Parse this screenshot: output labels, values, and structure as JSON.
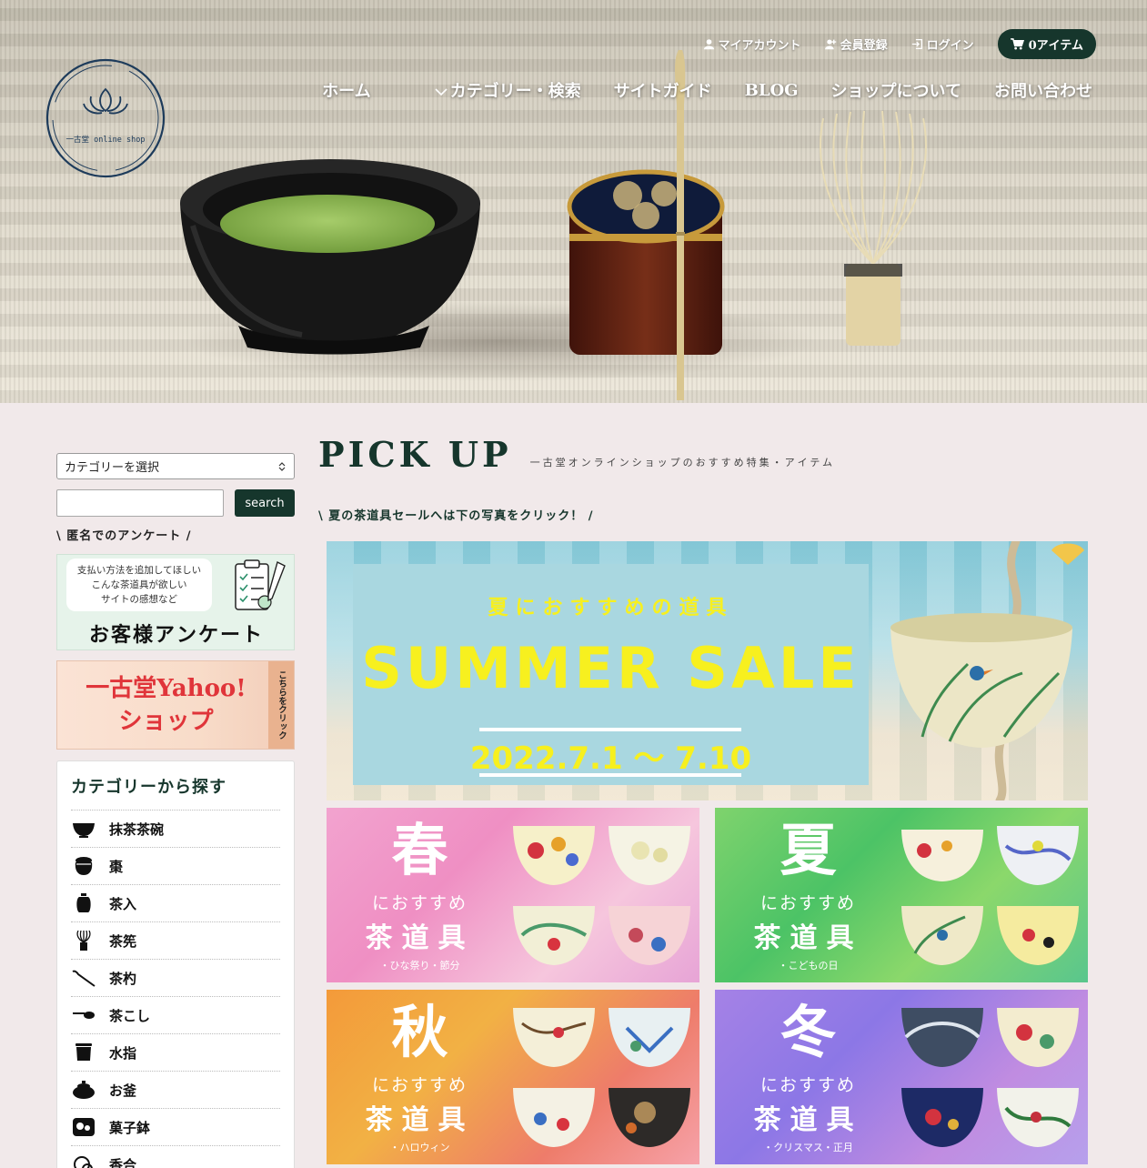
{
  "header": {
    "logo_text": "一古堂 online shop",
    "top_links": [
      {
        "label": "マイアカウント",
        "icon": "user-icon"
      },
      {
        "label": "会員登録",
        "icon": "user-plus-icon"
      },
      {
        "label": "ログイン",
        "icon": "login-icon"
      }
    ],
    "cart_label": "0アイテム",
    "nav": [
      "ホーム",
      "カテゴリー・検索",
      "サイトガイド",
      "BLOG",
      "ショップについて",
      "お問い合わせ"
    ]
  },
  "sidebar": {
    "category_select": "カテゴリーを選択",
    "search_input": "",
    "search_button": "search",
    "survey_label": "\\ 匿名でのアンケート /",
    "survey_banner": {
      "bubble_lines": [
        "支払い方法を追加してほしい",
        "こんな茶道具が欲しい",
        "サイトの感想など"
      ],
      "title": "お客様アンケート"
    },
    "yahoo_banner": {
      "line1": "一古堂Yahoo!",
      "line2": "ショップ",
      "side": "こちらをクリック"
    },
    "categories_title": "カテゴリーから探す",
    "categories": [
      {
        "label": "抹茶茶碗",
        "icon": "tea-bowl-icon"
      },
      {
        "label": "棗",
        "icon": "natsume-icon"
      },
      {
        "label": "茶入",
        "icon": "chaire-icon"
      },
      {
        "label": "茶筅",
        "icon": "chasen-icon"
      },
      {
        "label": "茶杓",
        "icon": "chashaku-icon"
      },
      {
        "label": "茶こし",
        "icon": "strainer-icon"
      },
      {
        "label": "水指",
        "icon": "mizusashi-icon"
      },
      {
        "label": "お釜",
        "icon": "kettle-icon"
      },
      {
        "label": "菓子鉢",
        "icon": "sweets-bowl-icon"
      },
      {
        "label": "香合",
        "icon": "incense-box-icon"
      }
    ]
  },
  "main": {
    "title": "PICK UP",
    "subtitle": "一古堂オンラインショップのおすすめ特集・アイテム",
    "sale_note": "\\ 夏の茶道具セールへは下の写真をクリック！ /",
    "sale_banner": {
      "sub": "夏におすすめの道具",
      "main": "SUMMER SALE",
      "date": "2022.7.1 ～ 7.10"
    },
    "seasons": [
      {
        "big": "春",
        "mid": "におすすめ",
        "tool": "茶道具",
        "note": "・ひな祭り・節分"
      },
      {
        "big": "夏",
        "mid": "におすすめ",
        "tool": "茶道具",
        "note": "・こどもの日"
      },
      {
        "big": "秋",
        "mid": "におすすめ",
        "tool": "茶道具",
        "note": "・ハロウィン"
      },
      {
        "big": "冬",
        "mid": "におすすめ",
        "tool": "茶道具",
        "note": "・クリスマス・正月"
      }
    ]
  },
  "colors": {
    "accent": "#16362c",
    "background": "#f1e9ea",
    "sale_yellow": "#f7f01f"
  }
}
